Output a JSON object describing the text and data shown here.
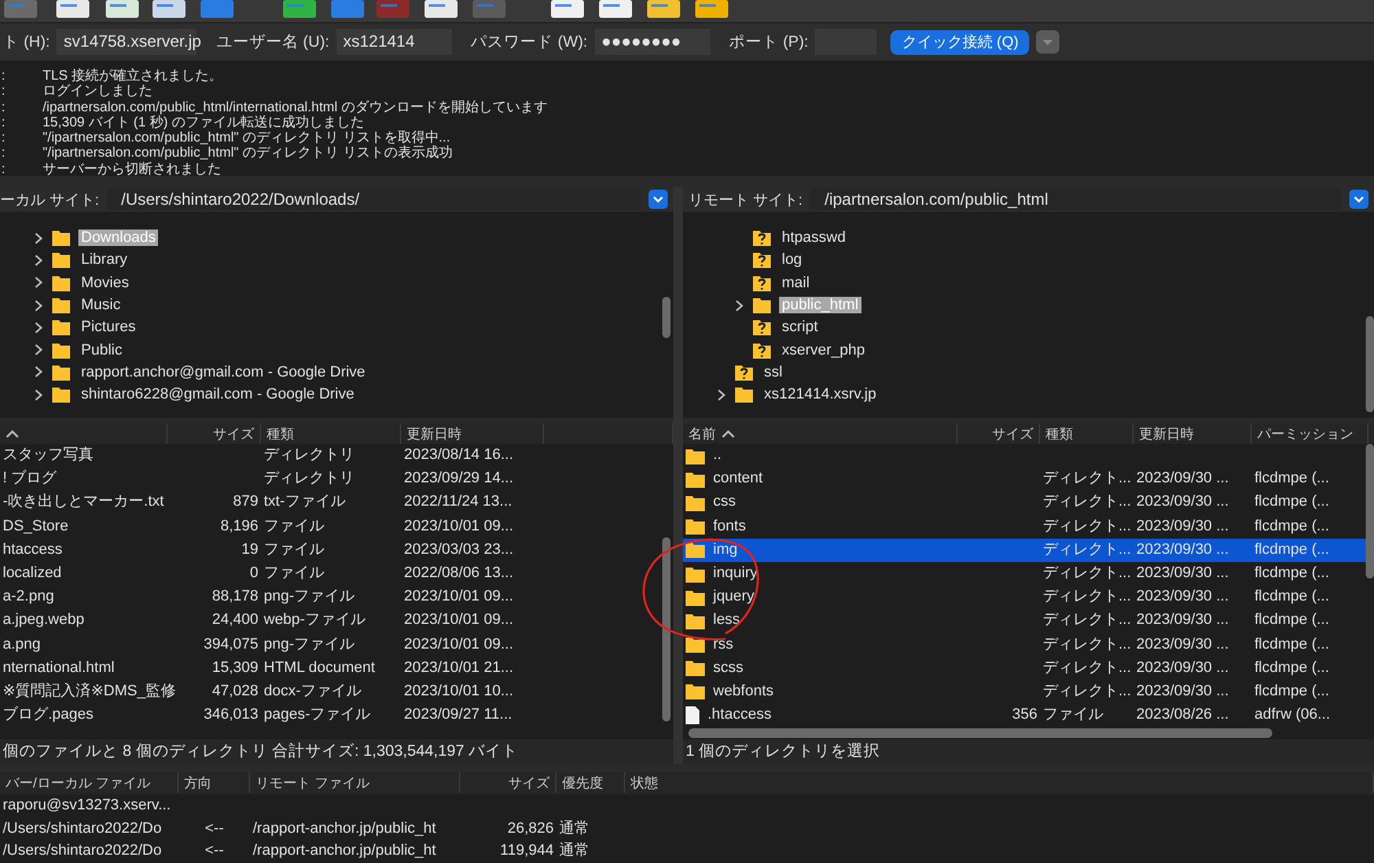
{
  "quickconnect": {
    "host_label": "ト (H):",
    "host": "sv14758.xserver.jp",
    "user_label": "ユーザー名 (U):",
    "user": "xs121414",
    "password_label": "パスワード (W):",
    "password": "●●●●●●●●",
    "port_label": "ポート (P):",
    "button": "クイック接続 (Q)"
  },
  "log": [
    {
      "prefix": ":",
      "text": "TLS 接続が確立されました。"
    },
    {
      "prefix": ":",
      "text": "ログインしました"
    },
    {
      "prefix": ":",
      "text": "/ipartnersalon.com/public_html/international.html のダウンロードを開始しています"
    },
    {
      "prefix": ":",
      "text": "15,309 バイト (1 秒) のファイル転送に成功しました"
    },
    {
      "prefix": ":",
      "text": "\"/ipartnersalon.com/public_html\" のディレクトリ リストを取得中..."
    },
    {
      "prefix": ":",
      "text": "\"/ipartnersalon.com/public_html\" のディレクトリ リストの表示成功"
    },
    {
      "prefix": ":",
      "text": "サーバーから切断されました"
    }
  ],
  "local": {
    "site_label": "ーカル サイト:",
    "path": "/Users/shintaro2022/Downloads/",
    "tree": [
      {
        "name": "Downloads",
        "kind": "folder",
        "expandable": true,
        "selected": true
      },
      {
        "name": "Library",
        "kind": "folder",
        "expandable": true,
        "selected": false
      },
      {
        "name": "Movies",
        "kind": "folder",
        "expandable": true,
        "selected": false
      },
      {
        "name": "Music",
        "kind": "folder",
        "expandable": true,
        "selected": false
      },
      {
        "name": "Pictures",
        "kind": "folder",
        "expandable": true,
        "selected": false
      },
      {
        "name": "Public",
        "kind": "folder",
        "expandable": true,
        "selected": false
      },
      {
        "name": "rapport.anchor@gmail.com - Google Drive",
        "kind": "folder",
        "expandable": true,
        "selected": false
      },
      {
        "name": "shintaro6228@gmail.com - Google Drive",
        "kind": "folder",
        "expandable": true,
        "selected": false
      }
    ],
    "columns": [
      {
        "sorted": true
      },
      {
        "label": "サイズ",
        "sorted": false
      },
      {
        "label": "種類",
        "sorted": false
      },
      {
        "label": "更新日時",
        "sorted": false
      },
      {
        "sorted": false
      }
    ],
    "rows": [
      {
        "name": "スタッフ写真",
        "type": "ディレクトリ",
        "modified": "2023/08/14 16...",
        "selected": false
      },
      {
        "name": "! ブログ",
        "type": "ディレクトリ",
        "modified": "2023/09/29 14...",
        "selected": false
      },
      {
        "name": "-吹き出しとマーカー.txt",
        "size": "879",
        "type": "txt-ファイル",
        "modified": "2022/11/24 13...",
        "selected": false
      },
      {
        "name": "DS_Store",
        "size": "8,196",
        "type": "ファイル",
        "modified": "2023/10/01 09...",
        "selected": false
      },
      {
        "name": "htaccess",
        "size": "19",
        "type": "ファイル",
        "modified": "2023/03/03 23...",
        "selected": false
      },
      {
        "name": "localized",
        "size": "0",
        "type": "ファイル",
        "modified": "2022/08/06 13...",
        "selected": false
      },
      {
        "name": "a-2.png",
        "size": "88,178",
        "type": "png-ファイル",
        "modified": "2023/10/01 09...",
        "selected": false
      },
      {
        "name": "a.jpeg.webp",
        "size": "24,400",
        "type": "webp-ファイル",
        "modified": "2023/10/01 09...",
        "selected": false
      },
      {
        "name": "a.png",
        "size": "394,075",
        "type": "png-ファイル",
        "modified": "2023/10/01 09...",
        "selected": false
      },
      {
        "name": "nternational.html",
        "size": "15,309",
        "type": "HTML document",
        "modified": "2023/10/01 21...",
        "selected": false
      },
      {
        "name": "※質問記入済※DMS_監修",
        "size": "47,028",
        "type": "docx-ファイル",
        "modified": "2023/10/01 10...",
        "selected": false
      },
      {
        "name": "ブログ.pages",
        "size": "346,013",
        "type": "pages-ファイル",
        "modified": "2023/09/27 11...",
        "selected": false
      }
    ],
    "status": "個のファイルと 8 個のディレクトリ 合計サイズ: 1,303,544,197 バイト"
  },
  "remote": {
    "site_label": "リモート サイト:",
    "path": "/ipartnersalon.com/public_html",
    "tree": [
      {
        "children": [
          {
            "name": "htpasswd",
            "kind": "unknown",
            "expandable": false,
            "selected": false
          },
          {
            "name": "log",
            "kind": "unknown",
            "expandable": false,
            "selected": false
          },
          {
            "name": "mail",
            "kind": "unknown",
            "expandable": false,
            "selected": false
          },
          {
            "name": "public_html",
            "kind": "folder",
            "expandable": true,
            "selected": true
          },
          {
            "name": "script",
            "kind": "unknown",
            "expandable": false,
            "selected": false
          },
          {
            "name": "xserver_php",
            "kind": "unknown",
            "expandable": false,
            "selected": false
          }
        ]
      },
      {
        "name": "ssl",
        "kind": "unknown",
        "expandable": false,
        "selected": false
      },
      {
        "name": "xs121414.xsrv.jp",
        "kind": "folder",
        "expandable": true,
        "selected": false
      }
    ],
    "columns": [
      {
        "label": "名前",
        "sorted": true
      },
      {
        "label": "サイズ",
        "sorted": false
      },
      {
        "label": "種類",
        "sorted": false
      },
      {
        "label": "更新日時",
        "sorted": false
      },
      {
        "label": "パーミッション",
        "sorted": false
      }
    ],
    "rows": [
      {
        "kind": "folder",
        "name": "..",
        "selected": false
      },
      {
        "kind": "folder",
        "name": "content",
        "type": "ディレクト...",
        "modified": "2023/09/30 ...",
        "permissions": "flcdmpe (...",
        "selected": false
      },
      {
        "kind": "folder",
        "name": "css",
        "type": "ディレクト...",
        "modified": "2023/09/30 ...",
        "permissions": "flcdmpe (...",
        "selected": false
      },
      {
        "kind": "folder",
        "name": "fonts",
        "type": "ディレクト...",
        "modified": "2023/09/30 ...",
        "permissions": "flcdmpe (...",
        "selected": false
      },
      {
        "kind": "folder",
        "name": "img",
        "type": "ディレクト...",
        "modified": "2023/09/30 ...",
        "permissions": "flcdmpe (...",
        "selected": true
      },
      {
        "kind": "folder",
        "name": "inquiry",
        "type": "ディレクト...",
        "modified": "2023/09/30 ...",
        "permissions": "flcdmpe (...",
        "selected": false
      },
      {
        "kind": "folder",
        "name": "jquery",
        "type": "ディレクト...",
        "modified": "2023/09/30 ...",
        "permissions": "flcdmpe (...",
        "selected": false
      },
      {
        "kind": "folder",
        "name": "less",
        "type": "ディレクト...",
        "modified": "2023/09/30 ...",
        "permissions": "flcdmpe (...",
        "selected": false
      },
      {
        "kind": "folder",
        "name": "rss",
        "type": "ディレクト...",
        "modified": "2023/09/30 ...",
        "permissions": "flcdmpe (...",
        "selected": false
      },
      {
        "kind": "folder",
        "name": "scss",
        "type": "ディレクト...",
        "modified": "2023/09/30 ...",
        "permissions": "flcdmpe (...",
        "selected": false
      },
      {
        "kind": "folder",
        "name": "webfonts",
        "type": "ディレクト...",
        "modified": "2023/09/30 ...",
        "permissions": "flcdmpe (...",
        "selected": false
      },
      {
        "kind": "file",
        "name": ".htaccess",
        "size": "356",
        "type": "ファイル",
        "modified": "2023/08/26 ...",
        "permissions": "adfrw (06...",
        "selected": false
      }
    ],
    "status": "1 個のディレクトリを選択"
  },
  "queue": {
    "columns": [
      "バー/ローカル ファイル",
      "方向",
      "リモート ファイル",
      "サイズ",
      "優先度",
      "状態"
    ],
    "rows": [
      {
        "local": "raporu@sv13273.xserv..."
      },
      {
        "local": "/Users/shintaro2022/Do",
        "direction": "<--",
        "remote": "/rapport-anchor.jp/public_ht",
        "size": "26,826",
        "priority": "通常"
      },
      {
        "local": "/Users/shintaro2022/Do",
        "direction": "<--",
        "remote": "/rapport-anchor.jp/public_ht",
        "size": "119,944",
        "priority": "通常"
      }
    ]
  }
}
